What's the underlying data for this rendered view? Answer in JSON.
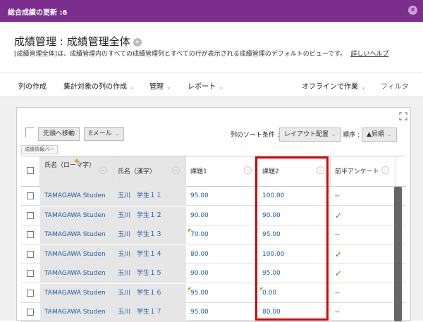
{
  "topbar": {
    "title": "総合成績の更新 :6",
    "close": "x"
  },
  "page": {
    "title": "成績管理 : 成績管理全体",
    "description": "[成績管理全体]は、成績管理内のすべての成績管理列とすべての行が表示される成績管理のデフォルトのビューです。",
    "help_link": "詳しいヘルプ"
  },
  "menu": {
    "create_column": "列の作成",
    "create_calc_column": "集計対象の列の作成",
    "manage": "管理",
    "reports": "レポート",
    "work_offline": "オフラインで作業",
    "filter": "フィルタ"
  },
  "toolbar": {
    "move_to_top": "先頭へ移動",
    "email": "Eメール",
    "sort_columns_label": "列のソート条件 :",
    "layout_order": "レイアウト配置",
    "order_label": "順序 :",
    "ascending": "▲昇順"
  },
  "info_bar": "成績情報バー",
  "columns": {
    "name_roman": "氏名（ローマ字）",
    "name_kanji": "氏名（漢字）",
    "task1": "課題1",
    "task2": "課題2",
    "survey": "前半アンケート"
  },
  "rows": [
    {
      "roman": "TAMAGAWA Studen",
      "kanji": "玉川　学生１１",
      "task1": "95.00",
      "task1_flag": false,
      "task2": "100.00",
      "task2_flag": false,
      "survey": "--",
      "survey_check": false
    },
    {
      "roman": "TAMAGAWA Studen",
      "kanji": "玉川　学生１２",
      "task1": "90.00",
      "task1_flag": false,
      "task2": "90.00",
      "task2_flag": false,
      "survey": "✓",
      "survey_check": true
    },
    {
      "roman": "TAMAGAWA Studen",
      "kanji": "玉川　学生１３",
      "task1": "70.00",
      "task1_flag": true,
      "task2": "95.00",
      "task2_flag": false,
      "survey": "--",
      "survey_check": false
    },
    {
      "roman": "TAMAGAWA Studen",
      "kanji": "玉川　学生１４",
      "task1": "80.00",
      "task1_flag": false,
      "task2": "100.00",
      "task2_flag": false,
      "survey": "✓",
      "survey_check": true
    },
    {
      "roman": "TAMAGAWA Studen",
      "kanji": "玉川　学生１５",
      "task1": "90.00",
      "task1_flag": false,
      "task2": "95.00",
      "task2_flag": false,
      "survey": "✓",
      "survey_check": true
    },
    {
      "roman": "TAMAGAWA Studen",
      "kanji": "玉川　学生１６",
      "task1": "95.00",
      "task1_flag": true,
      "task2": "0.00",
      "task2_flag": true,
      "survey": "--",
      "survey_check": false
    },
    {
      "roman": "TAMAGAWA Studen",
      "kanji": "玉川　学生１７",
      "task1": "95.00",
      "task1_flag": false,
      "task2": "80.00",
      "task2_flag": false,
      "survey": "--",
      "survey_check": false
    }
  ]
}
